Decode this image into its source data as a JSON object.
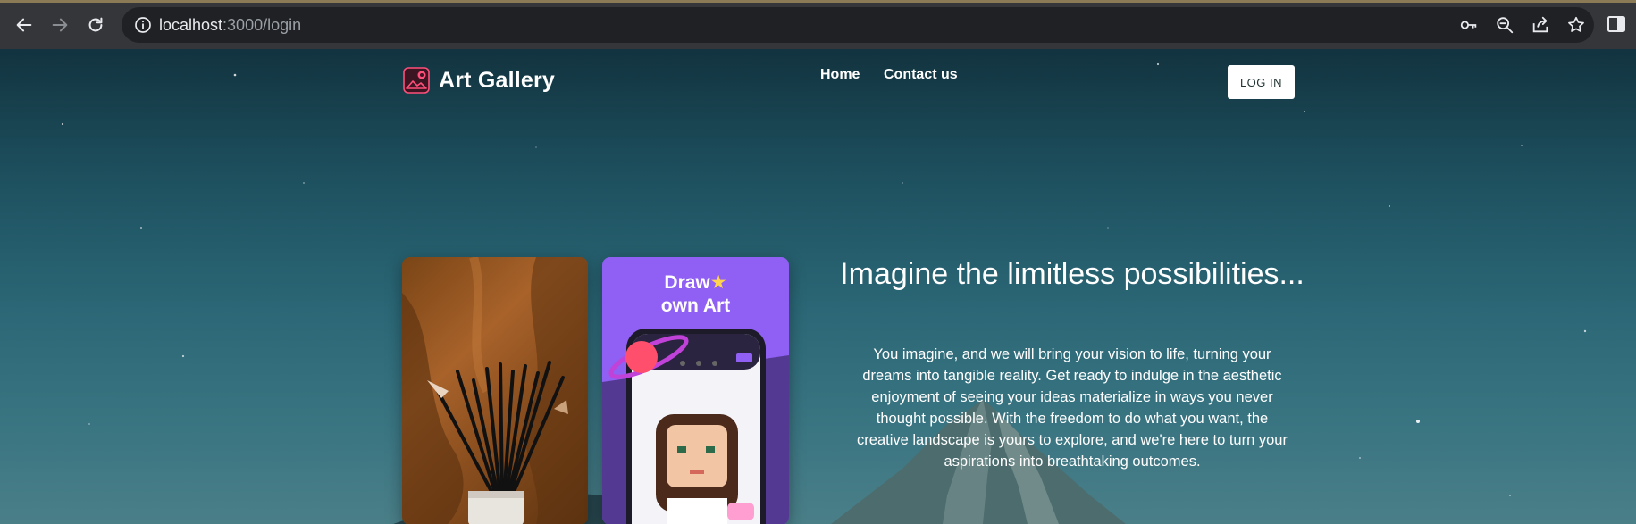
{
  "browser": {
    "url_host": "localhost",
    "url_rest": ":3000/login"
  },
  "nav": {
    "brand": "Art Gallery",
    "links": [
      "Home",
      "Contact us"
    ],
    "login": "LOG IN"
  },
  "cards": {
    "promo_title_line1": "Draw",
    "promo_title_line2": "own Art"
  },
  "hero": {
    "title": "Imagine the limitless possibilities...",
    "body": "You imagine, and we will bring your vision to life, turning your dreams into tangible reality. Get ready to indulge in the aesthetic enjoyment of seeing your ideas materialize in ways you never thought possible. With the freedom to do what you want, the creative landscape is yours to explore, and we're here to turn your aspirations into breathtaking outcomes."
  },
  "colors": {
    "accent_purple": "#8f60f3",
    "logo_pink": "#ff4f7a"
  }
}
